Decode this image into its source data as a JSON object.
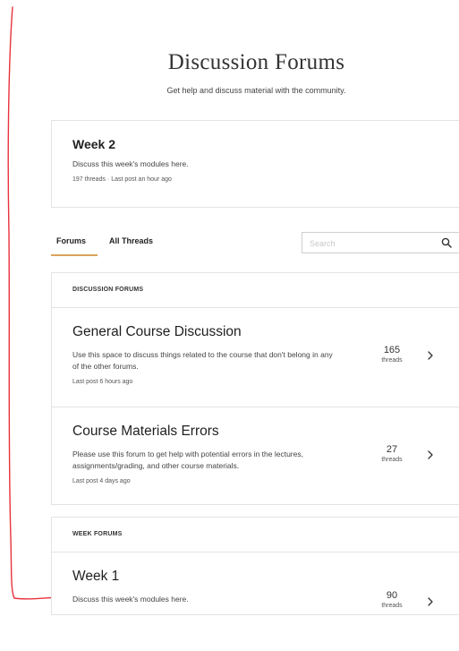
{
  "header": {
    "title": "Discussion Forums",
    "subtitle": "Get help and discuss material with the community."
  },
  "featured": {
    "title": "Week 2",
    "description": "Discuss this week's modules here.",
    "meta": "197 threads · Last post an hour ago"
  },
  "tabs": [
    {
      "label": "Forums",
      "active": true
    },
    {
      "label": "All Threads",
      "active": false
    }
  ],
  "search": {
    "placeholder": "Search",
    "value": "",
    "icon": "search-icon"
  },
  "sections": [
    {
      "header": "DISCUSSION FORUMS",
      "forums": [
        {
          "title": "General Course Discussion",
          "description": "Use this space to discuss things related to the course that don't belong in any of the other forums.",
          "meta": "Last post 6 hours ago",
          "count": "165",
          "count_label": "threads"
        },
        {
          "title": "Course Materials Errors",
          "description": "Please use this forum to get help with potential errors in the lectures, assignments/grading, and other course materials.",
          "meta": "Last post 4 days ago",
          "count": "27",
          "count_label": "threads"
        }
      ]
    },
    {
      "header": "WEEK FORUMS",
      "forums": [
        {
          "title": "Week 1",
          "description": "Discuss this week's modules here.",
          "count": "90",
          "count_label": "threads"
        }
      ]
    }
  ],
  "colors": {
    "accent": "#d9a35b",
    "annotation": "#e8323c",
    "border": "#e3e3e3"
  }
}
